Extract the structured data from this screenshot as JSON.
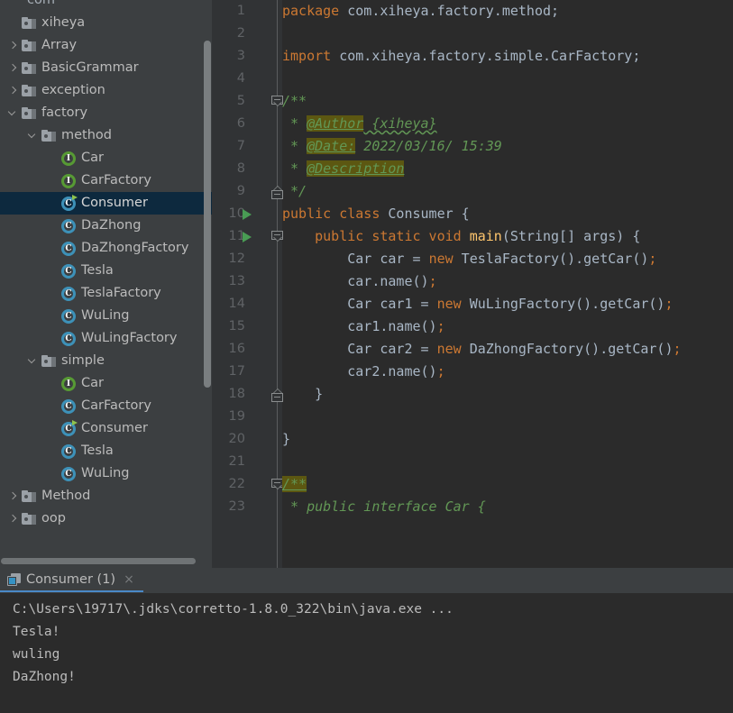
{
  "sidebar": {
    "scroll": {
      "vertical_present": true,
      "horizontal_present": true
    },
    "tree": [
      {
        "indent": 0,
        "twisty": "none",
        "icon": "none",
        "label": "com"
      },
      {
        "indent": 0,
        "twisty": "none",
        "icon": "folder-icon",
        "label": "xiheya"
      },
      {
        "indent": 0,
        "twisty": "right",
        "icon": "folder-icon",
        "label": "Array"
      },
      {
        "indent": 0,
        "twisty": "right",
        "icon": "folder-icon",
        "label": "BasicGrammar"
      },
      {
        "indent": 0,
        "twisty": "right",
        "icon": "folder-icon",
        "label": "exception"
      },
      {
        "indent": 0,
        "twisty": "down",
        "icon": "folder-icon",
        "label": "factory"
      },
      {
        "indent": 1,
        "twisty": "down",
        "icon": "folder-icon",
        "label": "method"
      },
      {
        "indent": 2,
        "twisty": "none",
        "icon": "interface-icon",
        "label": "Car"
      },
      {
        "indent": 2,
        "twisty": "none",
        "icon": "interface-icon",
        "label": "CarFactory"
      },
      {
        "indent": 2,
        "twisty": "none",
        "icon": "class-runnable-icon",
        "label": "Consumer",
        "selected": true
      },
      {
        "indent": 2,
        "twisty": "none",
        "icon": "class-icon",
        "label": "DaZhong"
      },
      {
        "indent": 2,
        "twisty": "none",
        "icon": "class-icon",
        "label": "DaZhongFactory"
      },
      {
        "indent": 2,
        "twisty": "none",
        "icon": "class-icon",
        "label": "Tesla"
      },
      {
        "indent": 2,
        "twisty": "none",
        "icon": "class-icon",
        "label": "TeslaFactory"
      },
      {
        "indent": 2,
        "twisty": "none",
        "icon": "class-icon",
        "label": "WuLing"
      },
      {
        "indent": 2,
        "twisty": "none",
        "icon": "class-icon",
        "label": "WuLingFactory"
      },
      {
        "indent": 1,
        "twisty": "down",
        "icon": "folder-icon",
        "label": "simple"
      },
      {
        "indent": 2,
        "twisty": "none",
        "icon": "interface-icon",
        "label": "Car"
      },
      {
        "indent": 2,
        "twisty": "none",
        "icon": "class-icon",
        "label": "CarFactory"
      },
      {
        "indent": 2,
        "twisty": "none",
        "icon": "class-runnable-icon",
        "label": "Consumer"
      },
      {
        "indent": 2,
        "twisty": "none",
        "icon": "class-icon",
        "label": "Tesla"
      },
      {
        "indent": 2,
        "twisty": "none",
        "icon": "class-icon",
        "label": "WuLing"
      },
      {
        "indent": 0,
        "twisty": "right",
        "icon": "folder-icon",
        "label": "Method"
      },
      {
        "indent": 0,
        "twisty": "right",
        "icon": "folder-icon",
        "label": "oop"
      }
    ]
  },
  "editor": {
    "line_numbers": [
      "1",
      "2",
      "3",
      "4",
      "5",
      "6",
      "7",
      "8",
      "9",
      "10",
      "11",
      "12",
      "13",
      "14",
      "15",
      "16",
      "17",
      "18",
      "19",
      "20",
      "21",
      "22",
      "23"
    ],
    "run_gutter_lines": [
      10,
      11
    ],
    "fold_markers": [
      {
        "line": 5,
        "type": "open"
      },
      {
        "line": 9,
        "type": "end"
      },
      {
        "line": 11,
        "type": "open"
      },
      {
        "line": 18,
        "type": "end"
      },
      {
        "line": 22,
        "type": "open"
      }
    ],
    "lines": [
      {
        "n": 1,
        "text": "package com.xiheya.factory.method;"
      },
      {
        "n": 2,
        "text": ""
      },
      {
        "n": 3,
        "text": "import com.xiheya.factory.simple.CarFactory;"
      },
      {
        "n": 4,
        "text": ""
      },
      {
        "n": 5,
        "text": "/**"
      },
      {
        "n": 6,
        "text": " * @Author {xiheya}"
      },
      {
        "n": 7,
        "text": " * @Date: 2022/03/16/ 15:39"
      },
      {
        "n": 8,
        "text": " * @Description"
      },
      {
        "n": 9,
        "text": " */"
      },
      {
        "n": 10,
        "text": "public class Consumer {"
      },
      {
        "n": 11,
        "text": "    public static void main(String[] args) {"
      },
      {
        "n": 12,
        "text": "        Car car = new TeslaFactory().getCar();"
      },
      {
        "n": 13,
        "text": "        car.name();"
      },
      {
        "n": 14,
        "text": "        Car car1 = new WuLingFactory().getCar();"
      },
      {
        "n": 15,
        "text": "        car1.name();"
      },
      {
        "n": 16,
        "text": "        Car car2 = new DaZhongFactory().getCar();"
      },
      {
        "n": 17,
        "text": "        car2.name();"
      },
      {
        "n": 18,
        "text": "    }"
      },
      {
        "n": 19,
        "text": ""
      },
      {
        "n": 20,
        "text": "}"
      },
      {
        "n": 21,
        "text": ""
      },
      {
        "n": 22,
        "text": "/**"
      },
      {
        "n": 23,
        "text": " * public interface Car {"
      }
    ],
    "tokens": {
      "l1_kw": "package",
      "l1_rest": " com.xiheya.factory.method;",
      "l3_kw": "import",
      "l3_rest": " com.xiheya.factory.simple.CarFactory;",
      "l5": "/**",
      "l6_star": " * ",
      "l6_tag": "@Author",
      "l6_val": " {xiheya}",
      "l7_star": " * ",
      "l7_tag": "@Date:",
      "l7_val": " 2022/03/16/ 15:39",
      "l8_star": " * ",
      "l8_tag": "@Description",
      "l9": " */",
      "l10_a": "public class ",
      "l10_b": "Consumer",
      "l10_c": " {",
      "l11_a": "    public static void ",
      "l11_b": "main",
      "l11_c": "(String[] args) {",
      "l12_a": "        Car car = ",
      "l12_b": "new",
      "l12_c": " TeslaFactory().getCar()",
      "l12_d": ";",
      "l13_a": "        car.name()",
      "l13_d": ";",
      "l14_a": "        Car car1 = ",
      "l14_b": "new",
      "l14_c": " WuLingFactory().getCar()",
      "l14_d": ";",
      "l15_a": "        car1.name()",
      "l15_d": ";",
      "l16_a": "        Car car2 = ",
      "l16_b": "new",
      "l16_c": " DaZhongFactory().getCar()",
      "l16_d": ";",
      "l17_a": "        car2.name()",
      "l17_d": ";",
      "l18": "    }",
      "l20": "}",
      "l22": "/**",
      "l23": " * public interface Car {"
    }
  },
  "run_panel": {
    "tab_label": "Consumer (1)",
    "tab_close": "×",
    "output": [
      "C:\\Users\\19717\\.jdks\\corretto-1.8.0_322\\bin\\java.exe ...",
      "Tesla!",
      "wuling",
      "DaZhong!"
    ]
  },
  "colors": {
    "editor_bg": "#2b2b2b",
    "gutter_bg": "#313335",
    "sidebar_bg": "#3c3f41",
    "selection_bg": "#0d293e",
    "keyword": "#cc7832",
    "identifier": "#a9b7c6",
    "method": "#ffc66d",
    "comment": "#629755",
    "javadoc_tag_bg": "#5c5711",
    "run_green": "#499c54",
    "tab_underline": "#4a88c7"
  }
}
